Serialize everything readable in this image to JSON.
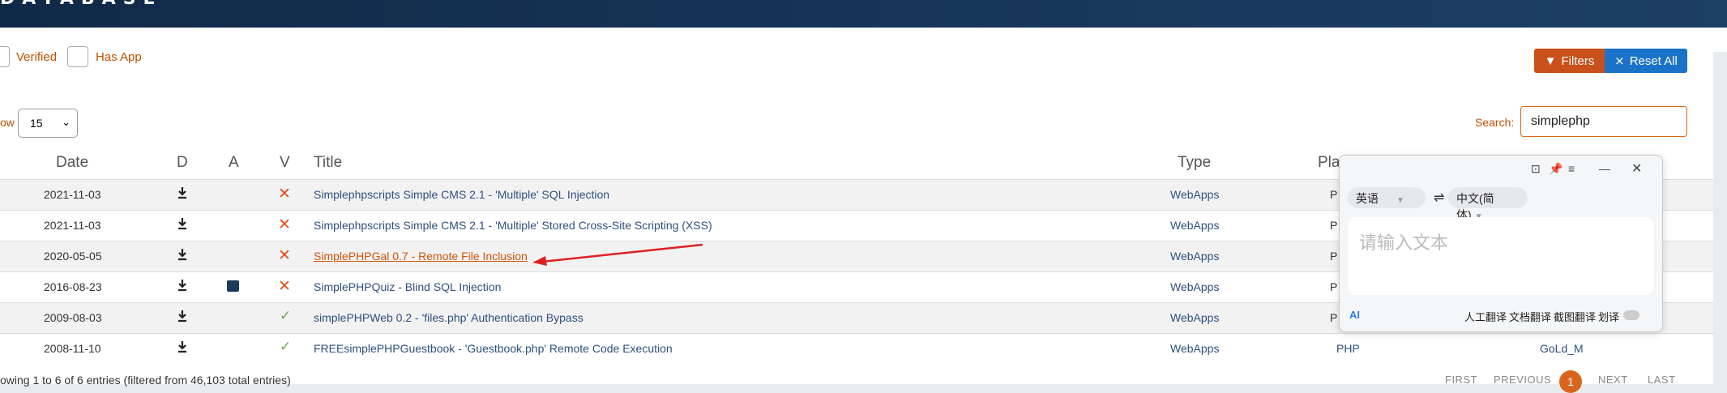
{
  "header": {
    "brand": "DATABASE"
  },
  "filters": {
    "verified_label": "Verified",
    "has_app_label": "Has App",
    "filters_button": "Filters",
    "reset_button": "Reset All"
  },
  "length": {
    "label": "ow",
    "value": "15"
  },
  "search": {
    "label": "Search:",
    "value": "simplephp"
  },
  "table": {
    "headers": {
      "date": "Date",
      "d": "D",
      "a": "A",
      "v": "V",
      "title": "Title",
      "type": "Type",
      "platform": "Plat"
    },
    "rows": [
      {
        "date": "2021-11-03",
        "title": "Simplephpscripts Simple CMS 2.1 - 'Multiple' SQL Injection",
        "type": "WebApps",
        "platform": "P",
        "verified": false,
        "app": false
      },
      {
        "date": "2021-11-03",
        "title": "Simplephpscripts Simple CMS 2.1 - 'Multiple' Stored Cross-Site Scripting (XSS)",
        "type": "WebApps",
        "platform": "P",
        "verified": false,
        "app": false
      },
      {
        "date": "2020-05-05",
        "title": "SimplePHPGal 0.7 - Remote File Inclusion",
        "type": "WebApps",
        "platform": "P",
        "verified": false,
        "app": false
      },
      {
        "date": "2016-08-23",
        "title": "SimplePHPQuiz - Blind SQL Injection",
        "type": "WebApps",
        "platform": "P",
        "verified": false,
        "app": true
      },
      {
        "date": "2009-08-03",
        "title": "simplePHPWeb 0.2 - 'files.php' Authentication Bypass",
        "type": "WebApps",
        "platform": "P",
        "verified": true,
        "app": false
      },
      {
        "date": "2008-11-10",
        "title": "FREEsimplePHPGuestbook - 'Guestbook.php' Remote Code Execution",
        "type": "WebApps",
        "platform": "PHP",
        "author": "GoLd_M",
        "verified": true,
        "app": false
      }
    ]
  },
  "footer": {
    "info": "owing 1 to 6 of 6 entries (filtered from 46,103 total entries)",
    "first": "FIRST",
    "previous": "PREVIOUS",
    "page": "1",
    "next": "NEXT",
    "last": "LAST"
  },
  "translator": {
    "source_lang": "英语",
    "target_lang": "中文(简体)",
    "placeholder": "请输入文本",
    "ai_label": "AI",
    "human_translate": "人工翻译",
    "doc_translate": "文档翻译",
    "screenshot_translate": "截图翻译",
    "word_translate": "划译",
    "swap_icon": "⇌"
  },
  "colors": {
    "accent": "#d9651c",
    "nav": "#0f2a47",
    "reset_btn": "#1a73c9",
    "link": "#2f4f7f"
  }
}
